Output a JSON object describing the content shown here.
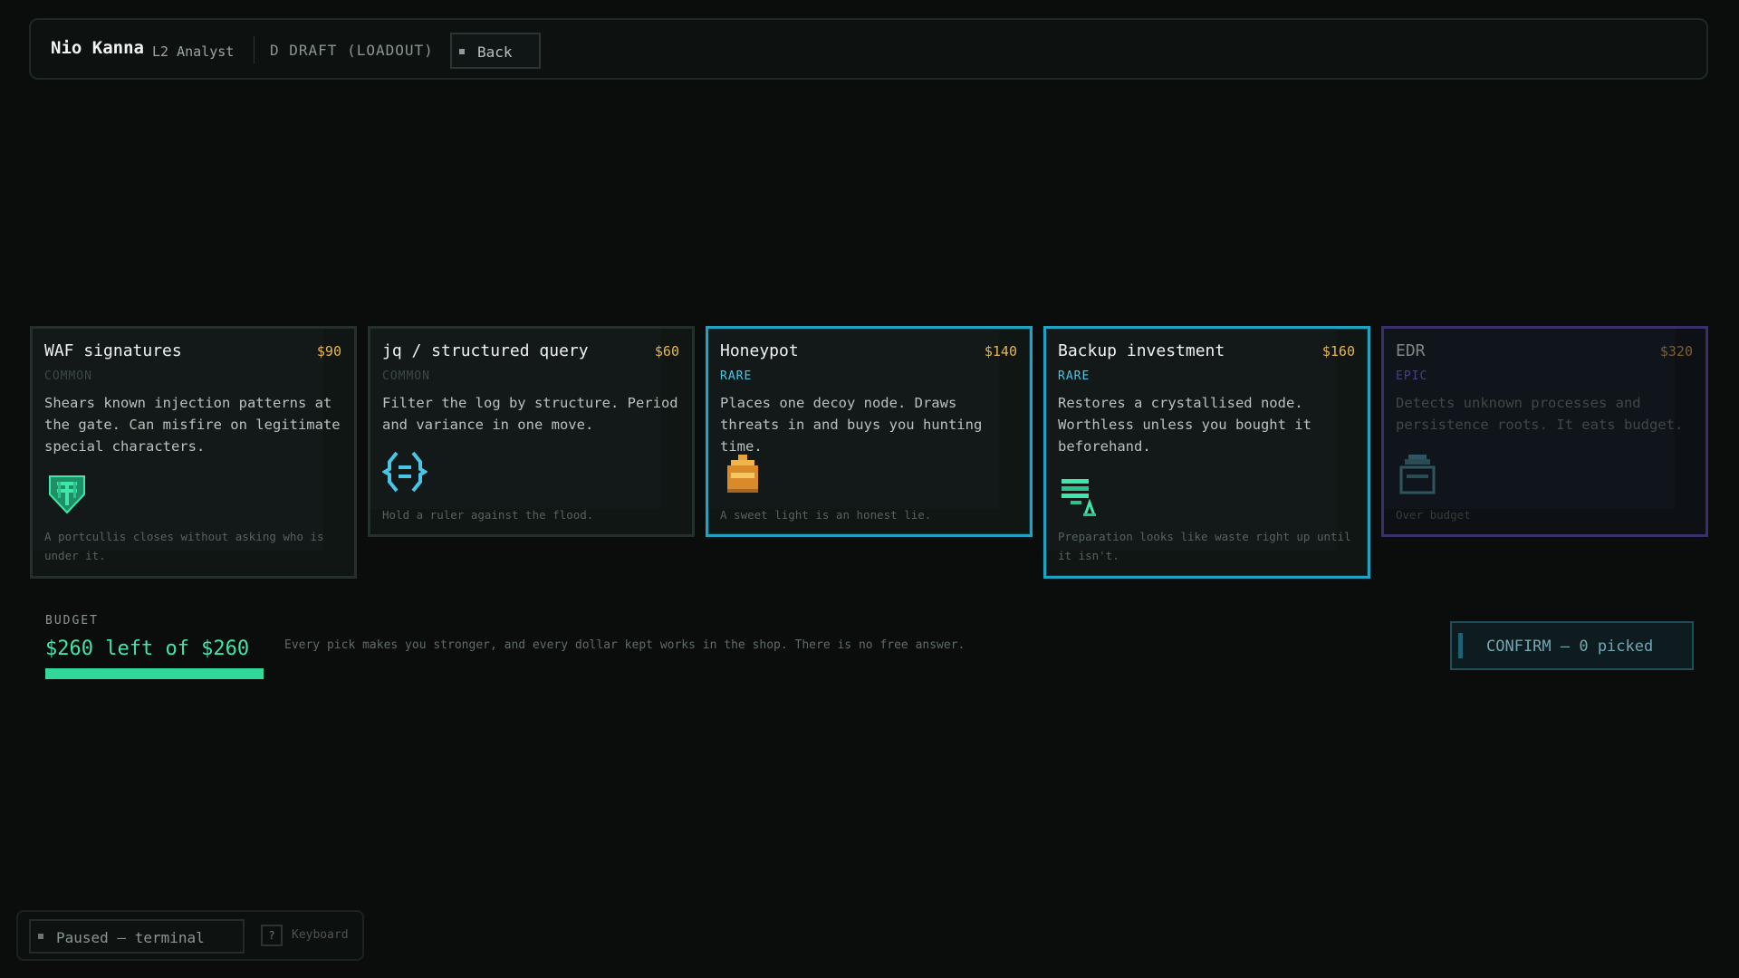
{
  "header": {
    "player_name": "Nio Kanna",
    "player_rank": "L2 Analyst",
    "phase": "D DRAFT (LOADOUT)",
    "back_label": "Back"
  },
  "cards": [
    {
      "title": "WAF signatures",
      "price": "$90",
      "rarity": "COMMON",
      "description": "Shears known injection patterns at the gate. Can misfire on legitimate special characters.",
      "flavor": "A portcullis closes without asking who is under it.",
      "icon": "shield-icon"
    },
    {
      "title": "jq / structured query",
      "price": "$60",
      "rarity": "COMMON",
      "description": "Filter the log by structure. Period and variance in one move.",
      "flavor": "Hold a ruler against the flood.",
      "icon": "query-brackets-icon"
    },
    {
      "title": "Honeypot",
      "price": "$140",
      "rarity": "RARE",
      "description": "Places one decoy node. Draws threats in and buys you hunting time.",
      "flavor": "A sweet light is an honest lie.",
      "icon": "honeypot-icon"
    },
    {
      "title": "Backup investment",
      "price": "$160",
      "rarity": "RARE",
      "description": "Restores a crystallised node. Worthless unless you bought it beforehand.",
      "flavor": "Preparation looks like waste right up until it isn't.",
      "icon": "backup-stack-icon"
    },
    {
      "title": "EDR",
      "price": "$320",
      "rarity": "EPIC",
      "description": "Detects unknown processes and persistence roots. It eats budget.",
      "flavor": "Over budget",
      "icon": "sensor-icon"
    }
  ],
  "budget": {
    "label": "BUDGET",
    "amount_text": "$260 left of $260",
    "remaining": 260,
    "total": 260,
    "hint": "Every pick makes you stronger, and every dollar kept works in the shop. There is no free answer."
  },
  "confirm_label": "CONFIRM — 0 picked",
  "footer": {
    "pause_label": "Paused — terminal",
    "key_glyph": "?",
    "keyboard_label": "Keyboard"
  },
  "colors": {
    "accent_green": "#3ee6a8",
    "rare_blue": "#1fa3c2",
    "epic_purple": "#3a2f6a",
    "price_gold": "#e8b54a"
  }
}
